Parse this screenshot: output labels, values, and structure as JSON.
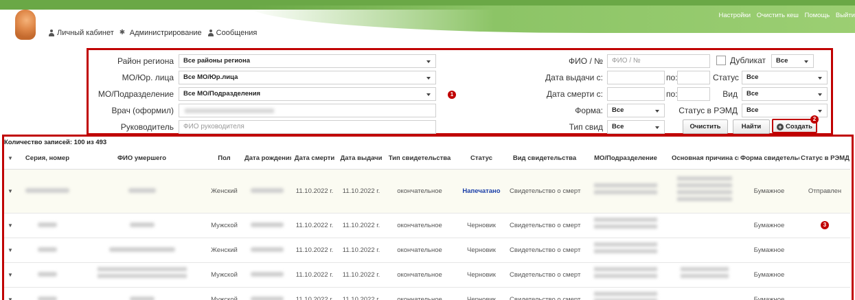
{
  "header": {
    "top_links": [
      "Настройки",
      "Очистить кеш",
      "Помощь",
      "Выйти"
    ],
    "nav": [
      {
        "label": "Личный кабинет",
        "icon": "user-icon"
      },
      {
        "label": "Администрирование",
        "icon": "tools-icon"
      },
      {
        "label": "Сообщения",
        "icon": "user-icon"
      }
    ]
  },
  "filters": {
    "region_label": "Район региона",
    "region_value": "Все районы региона",
    "mo_label": "МО/Юр. лица",
    "mo_value": "Все МО/Юр.лица",
    "subdiv_label": "МО/Подразделение",
    "subdiv_value": "Все МО/Подразделения",
    "doctor_label": "Врач (оформил)",
    "head_label": "Руководитель",
    "head_placeholder": "ФИО руководителя",
    "fio_label": "ФИО / №",
    "fio_placeholder": "ФИО / №",
    "duplicate_label": "Дубликат",
    "duplicate_value": "Все",
    "issue_from_label": "Дата выдачи с:",
    "issue_to_label": "по:",
    "status_label": "Статус",
    "status_value": "Все",
    "death_from_label": "Дата смерти с:",
    "death_to_label": "по:",
    "kind_label": "Вид",
    "kind_value": "Все",
    "form_label": "Форма:",
    "form_value": "Все",
    "remd_label": "Статус в РЭМД",
    "remd_value": "Все",
    "type_label": "Тип свид",
    "type_value": "Все",
    "clear_button": "Очистить",
    "find_button": "Найти",
    "create_button": "Создать",
    "badge1": "1",
    "badge2": "2"
  },
  "table": {
    "count_text": "Количество записей: 100 из 493",
    "badge3": "3",
    "columns": [
      "",
      "Серия, номер",
      "ФИО умершего",
      "Пол",
      "Дата рождения",
      "Дата смерти",
      "Дата выдачи",
      "Тип свидетельства",
      "Статус",
      "Вид свидетельства",
      "МО/Подразделение",
      "Основная причина смерти",
      "Форма свидетельства",
      "Статус в РЭМД"
    ],
    "rows": [
      {
        "sex": "Женский",
        "death": "11.10.2022 г.",
        "issue": "11.10.2022 г.",
        "type": "окончательное",
        "status": "Напечатано",
        "kind": "Свидетельство о смерти",
        "form": "Бумажное",
        "remd": "Отправлен"
      },
      {
        "sex": "Мужской",
        "death": "11.10.2022 г.",
        "issue": "11.10.2022 г.",
        "type": "окончательное",
        "status": "Черновик",
        "kind": "Свидетельство о смерти",
        "form": "Бумажное",
        "remd": ""
      },
      {
        "sex": "Женский",
        "death": "11.10.2022 г.",
        "issue": "11.10.2022 г.",
        "type": "окончательное",
        "status": "Черновик",
        "kind": "Свидетельство о смерти",
        "form": "Бумажное",
        "remd": ""
      },
      {
        "sex": "Мужской",
        "death": "11.10.2022 г.",
        "issue": "11.10.2022 г.",
        "type": "окончательное",
        "status": "Черновик",
        "kind": "Свидетельство о смерти",
        "form": "Бумажное",
        "remd": ""
      },
      {
        "sex": "Мужской",
        "death": "11.10.2022 г.",
        "issue": "11.10.2022 г.",
        "type": "окончательное",
        "status": "Черновик",
        "kind": "Свидетельство о смерти",
        "form": "Бумажное",
        "remd": ""
      }
    ]
  }
}
